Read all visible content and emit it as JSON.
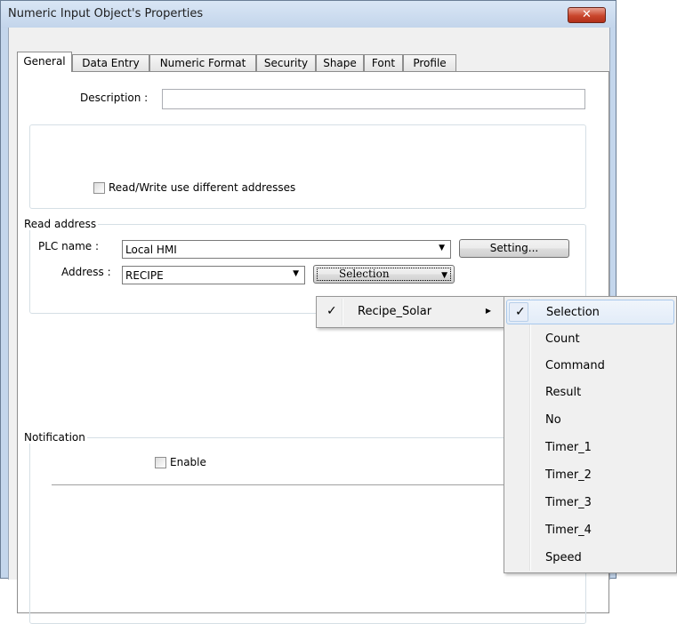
{
  "window": {
    "title": "Numeric Input Object's Properties",
    "close_glyph": "✕"
  },
  "tabs": [
    {
      "label": "General",
      "active": true
    },
    {
      "label": "Data Entry"
    },
    {
      "label": "Numeric Format"
    },
    {
      "label": "Security"
    },
    {
      "label": "Shape"
    },
    {
      "label": "Font"
    },
    {
      "label": "Profile"
    }
  ],
  "general": {
    "description_label": "Description :",
    "description_value": "",
    "rw_checkbox_label": "Read/Write use different addresses",
    "read_address": {
      "group_title": "Read address",
      "plc_label": "PLC name :",
      "plc_value": "Local HMI",
      "setting_button": "Setting...",
      "address_label": "Address :",
      "address_value": "RECIPE",
      "selection_button": "Selection"
    },
    "notification": {
      "group_title": "Notification",
      "enable_label": "Enable"
    }
  },
  "menus": {
    "recipe_menu": [
      {
        "label": "Recipe_Solar",
        "checked": true,
        "submenu": true
      }
    ],
    "field_menu": [
      {
        "label": "Selection",
        "checked": true,
        "highlighted": true
      },
      {
        "label": "Count"
      },
      {
        "label": "Command"
      },
      {
        "label": "Result"
      },
      {
        "label": "No"
      },
      {
        "label": "Timer_1"
      },
      {
        "label": "Timer_2"
      },
      {
        "label": "Timer_3"
      },
      {
        "label": "Timer_4"
      },
      {
        "label": "Speed"
      }
    ]
  },
  "icons": {
    "check": "✓",
    "dropdown": "▼",
    "submenu": "▶"
  }
}
